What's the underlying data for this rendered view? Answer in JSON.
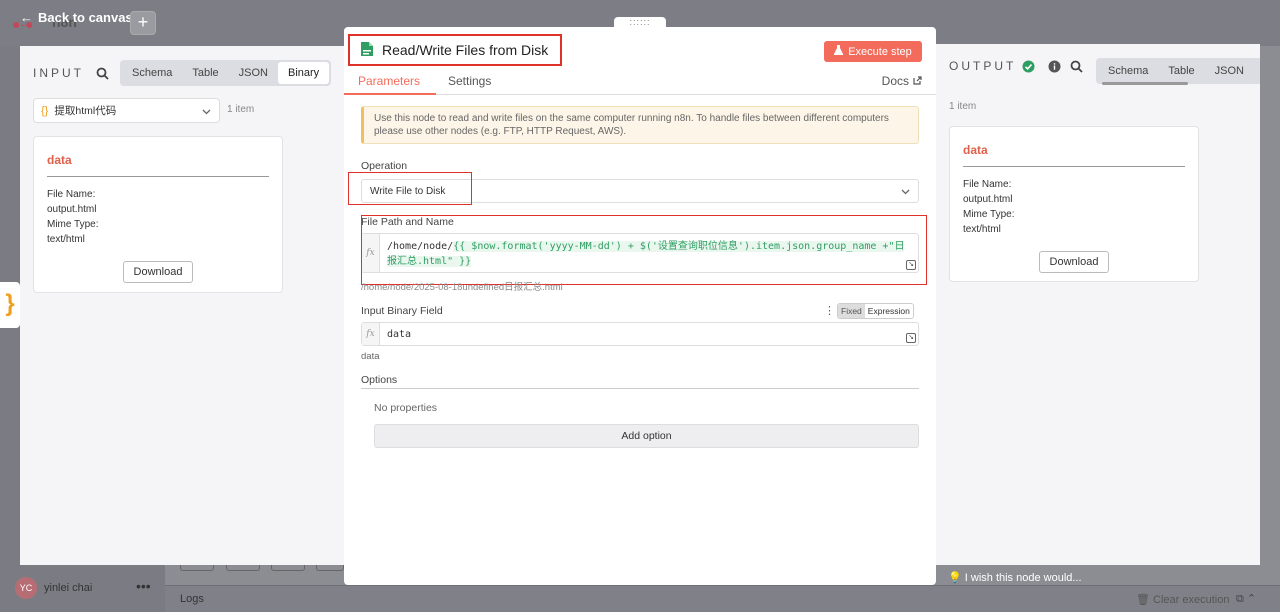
{
  "app": {
    "back_label": "Back to canvas",
    "logo_text": "n8n",
    "user_initials": "YC",
    "user_name": "yinlei chai",
    "more": "•••",
    "logs_label": "Logs",
    "wish_label": "I wish this node would...",
    "clear_execution": "Clear execution",
    "plus": "+",
    "handle": "::::::",
    "brace": "}"
  },
  "input_panel": {
    "title": "INPUT",
    "view_tabs": [
      "Schema",
      "Table",
      "JSON",
      "Binary"
    ],
    "active_tab": "Binary",
    "node_select": {
      "icon": "{}",
      "value": "提取html代码"
    },
    "item_count": "1 item",
    "card": {
      "title": "data",
      "file_name_label": "File Name:",
      "file_name": "output.html",
      "mime_label": "Mime Type:",
      "mime": "text/html",
      "download": "Download"
    }
  },
  "output_panel": {
    "title": "OUTPUT",
    "view_tabs": [
      "Schema",
      "Table",
      "JSON"
    ],
    "item_count": "1 item",
    "card": {
      "title": "data",
      "file_name_label": "File Name:",
      "file_name": "output.html",
      "mime_label": "Mime Type:",
      "mime": "text/html",
      "download": "Download"
    }
  },
  "modal": {
    "title": "Read/Write Files from Disk",
    "execute_label": "Execute step",
    "tabs": [
      "Parameters",
      "Settings"
    ],
    "docs_label": "Docs",
    "notice": "Use this node to read and write files on the same computer running n8n. To handle files between different computers please use other nodes (e.g. FTP, HTTP Request, AWS).",
    "operation": {
      "label": "Operation",
      "value": "Write File to Disk"
    },
    "file_path": {
      "label": "File Path and Name",
      "prefix": "/home/node/",
      "expression_line1": "{{ $now.format('yyyy-MM-dd')  + $('设置查询职位信息').item.json.group_name +\"日",
      "expression_line2": "报汇总.html\" }}",
      "resolved": "/home/node/2025-08-18undefined日报汇总.html"
    },
    "binary_field": {
      "label": "Input Binary Field",
      "value": "data",
      "hint": "data",
      "mode_fixed": "Fixed",
      "mode_expression": "Expression",
      "kebab": "⋮"
    },
    "options": {
      "label": "Options",
      "empty": "No properties",
      "add_label": "Add option"
    }
  },
  "colors": {
    "accent": "#f26b5b",
    "highlight_red": "#e0302a",
    "success_green": "#2f9e62"
  }
}
